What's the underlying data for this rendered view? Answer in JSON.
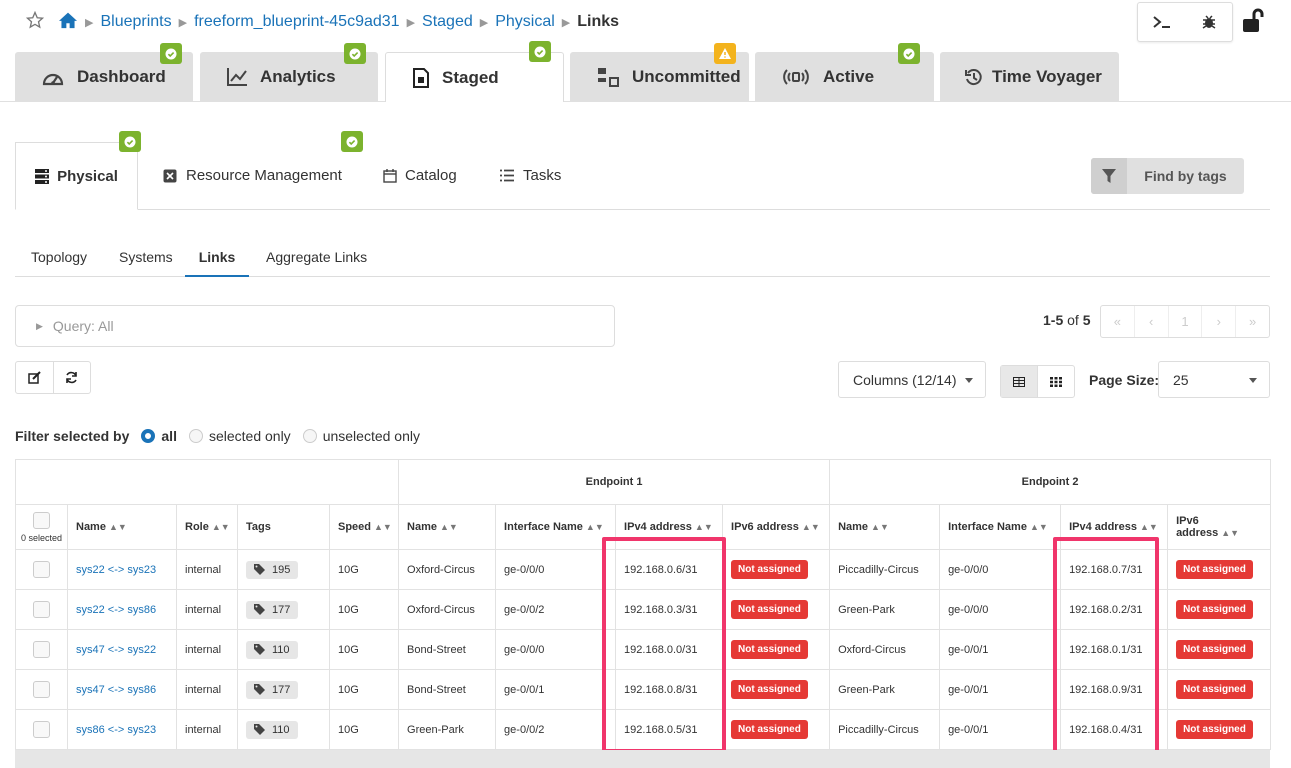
{
  "breadcrumb": {
    "items": [
      "Blueprints",
      "freeform_blueprint-45c9ad31",
      "Staged",
      "Physical"
    ],
    "current": "Links"
  },
  "main_tabs": [
    {
      "label": "Dashboard",
      "icon": "dashboard-icon",
      "badge": "ok"
    },
    {
      "label": "Analytics",
      "icon": "analytics-icon",
      "badge": "ok"
    },
    {
      "label": "Staged",
      "icon": "staged-icon",
      "badge": "ok",
      "active": true
    },
    {
      "label": "Uncommitted",
      "icon": "uncommitted-icon",
      "badge": "warn"
    },
    {
      "label": "Active",
      "icon": "active-icon",
      "badge": "ok"
    },
    {
      "label": "Time Voyager",
      "icon": "history-icon"
    }
  ],
  "sub_tabs": [
    "Physical",
    "Resource Management",
    "Catalog",
    "Tasks"
  ],
  "find_by_tags": "Find by tags",
  "view_tabs": [
    "Topology",
    "Systems",
    "Links",
    "Aggregate Links"
  ],
  "query": {
    "label": "Query: All"
  },
  "pager": {
    "range": "1-5",
    "of": "of",
    "total": "5",
    "first": "«",
    "prev": "‹",
    "page": "1",
    "next": "›",
    "last": "»"
  },
  "columns_button": "Columns (12/14)",
  "page_size": {
    "label": "Page Size:",
    "value": "25"
  },
  "filter": {
    "label": "Filter selected by",
    "options": [
      "all",
      "selected only",
      "unselected only"
    ],
    "selected": "all"
  },
  "table": {
    "groups": {
      "endpoint1": "Endpoint 1",
      "endpoint2": "Endpoint 2"
    },
    "selected_count": "0 selected",
    "headers": [
      "Name",
      "Role",
      "Tags",
      "Speed",
      "Name",
      "Interface Name",
      "IPv4 address",
      "IPv6 address",
      "Name",
      "Interface Name",
      "IPv4 address",
      "IPv6 address"
    ],
    "rows": [
      {
        "name": "sys22 <-> sys23",
        "role": "internal",
        "tags": "195",
        "speed": "10G",
        "e1_name": "Oxford-Circus",
        "e1_if": "ge-0/0/0",
        "e1_ipv4": "192.168.0.6/31",
        "e1_ipv6": "Not assigned",
        "e2_name": "Piccadilly-Circus",
        "e2_if": "ge-0/0/0",
        "e2_ipv4": "192.168.0.7/31",
        "e2_ipv6": "Not assigned"
      },
      {
        "name": "sys22 <-> sys86",
        "role": "internal",
        "tags": "177",
        "speed": "10G",
        "e1_name": "Oxford-Circus",
        "e1_if": "ge-0/0/2",
        "e1_ipv4": "192.168.0.3/31",
        "e1_ipv6": "Not assigned",
        "e2_name": "Green-Park",
        "e2_if": "ge-0/0/0",
        "e2_ipv4": "192.168.0.2/31",
        "e2_ipv6": "Not assigned"
      },
      {
        "name": "sys47 <-> sys22",
        "role": "internal",
        "tags": "110",
        "speed": "10G",
        "e1_name": "Bond-Street",
        "e1_if": "ge-0/0/0",
        "e1_ipv4": "192.168.0.0/31",
        "e1_ipv6": "Not assigned",
        "e2_name": "Oxford-Circus",
        "e2_if": "ge-0/0/1",
        "e2_ipv4": "192.168.0.1/31",
        "e2_ipv6": "Not assigned"
      },
      {
        "name": "sys47 <-> sys86",
        "role": "internal",
        "tags": "177",
        "speed": "10G",
        "e1_name": "Bond-Street",
        "e1_if": "ge-0/0/1",
        "e1_ipv4": "192.168.0.8/31",
        "e1_ipv6": "Not assigned",
        "e2_name": "Green-Park",
        "e2_if": "ge-0/0/1",
        "e2_ipv4": "192.168.0.9/31",
        "e2_ipv6": "Not assigned"
      },
      {
        "name": "sys86 <-> sys23",
        "role": "internal",
        "tags": "110",
        "speed": "10G",
        "e1_name": "Green-Park",
        "e1_if": "ge-0/0/2",
        "e1_ipv4": "192.168.0.5/31",
        "e1_ipv6": "Not assigned",
        "e2_name": "Piccadilly-Circus",
        "e2_if": "ge-0/0/1",
        "e2_ipv4": "192.168.0.4/31",
        "e2_ipv6": "Not assigned"
      }
    ]
  },
  "colors": {
    "accent": "#1a73b8",
    "ok_badge": "#7cb32e",
    "warn_badge": "#f3b31d",
    "not_assigned": "#e53935",
    "highlight": "#f0356b"
  }
}
